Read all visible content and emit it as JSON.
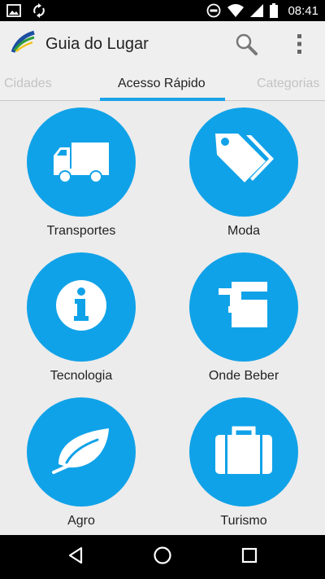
{
  "status_bar": {
    "time": "08:41",
    "icons": [
      "image-icon",
      "sync-icon",
      "dnd-icon",
      "wifi-icon",
      "signal-icon",
      "battery-icon"
    ]
  },
  "app_bar": {
    "title": "Guia do Lugar",
    "icons": [
      "app-logo-icon",
      "search-icon",
      "overflow-menu-icon"
    ]
  },
  "tabs": [
    {
      "label": "Cidades",
      "active": false
    },
    {
      "label": "Acesso Rápido",
      "active": true
    },
    {
      "label": "Categorias",
      "active": false
    }
  ],
  "tiles": [
    {
      "label": "Transportes",
      "icon": "truck-icon"
    },
    {
      "label": "Moda",
      "icon": "tags-icon"
    },
    {
      "label": "Tecnologia",
      "icon": "info-icon"
    },
    {
      "label": "Onde Beber",
      "icon": "beer-mug-icon"
    },
    {
      "label": "Agro",
      "icon": "leaf-icon"
    },
    {
      "label": "Turismo",
      "icon": "suitcase-icon"
    }
  ],
  "nav_bar": {
    "icons": [
      "back-icon",
      "home-icon",
      "recents-icon"
    ]
  },
  "colors": {
    "accent": "#10a2e8",
    "background": "#ececec",
    "bars": "#000000"
  }
}
